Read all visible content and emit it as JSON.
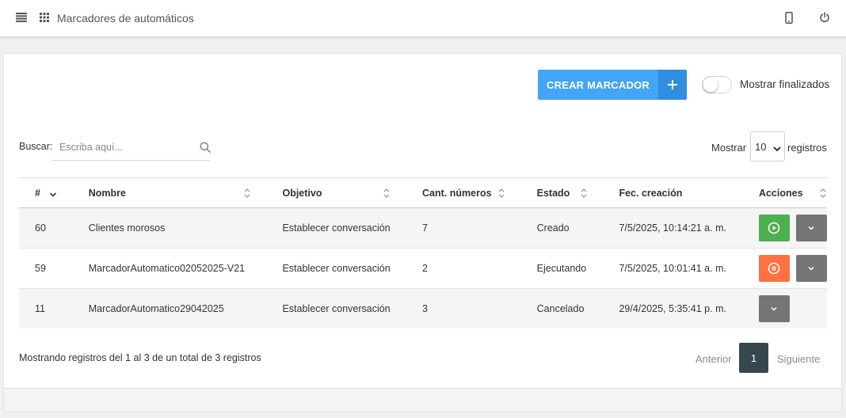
{
  "header": {
    "title": "Marcadores de automáticos",
    "icons": [
      "menu-icon",
      "apps-grid-icon",
      "mobile-phone-icon",
      "power-icon"
    ]
  },
  "toolbar": {
    "create_label": "CREAR MARCADOR",
    "create_plus": "+",
    "toggle_label": "Mostrar finalizados",
    "toggle_on": false
  },
  "search": {
    "label": "Buscar:",
    "placeholder": "Escriba aquí...",
    "value": ""
  },
  "page_size": {
    "label_before": "Mostrar",
    "value": "10",
    "label_after": "registros"
  },
  "table": {
    "columns": [
      "#",
      "Nombre",
      "Objetivo",
      "Cant. números",
      "Estado",
      "Fec. creación",
      "Acciones"
    ],
    "rows": [
      {
        "id": "60",
        "nombre": "Clientes morosos",
        "objetivo": "Establecer conversación",
        "cantidad": "7",
        "estado": "Creado",
        "fecha": "7/5/2025, 10:14:21 a. m.",
        "action": "play"
      },
      {
        "id": "59",
        "nombre": "MarcadorAutomatico02052025-V21",
        "objetivo": "Establecer conversación",
        "cantidad": "2",
        "estado": "Ejecutando",
        "fecha": "7/5/2025, 10:01:41 a. m.",
        "action": "pause"
      },
      {
        "id": "11",
        "nombre": "MarcadorAutomatico29042025",
        "objetivo": "Establecer conversación",
        "cantidad": "3",
        "estado": "Cancelado",
        "fecha": "29/4/2025, 5:35:41 p. m.",
        "action": "none"
      }
    ]
  },
  "pagination": {
    "info": "Mostrando registros del 1 al 3 de un total de 3 registros",
    "prev": "Anterior",
    "current": "1",
    "next": "Siguiente"
  },
  "colors": {
    "primary": "#42a5f5",
    "play": "#4caf50",
    "pause": "#ff7043",
    "more": "#757575",
    "page_active": "#37474f"
  }
}
